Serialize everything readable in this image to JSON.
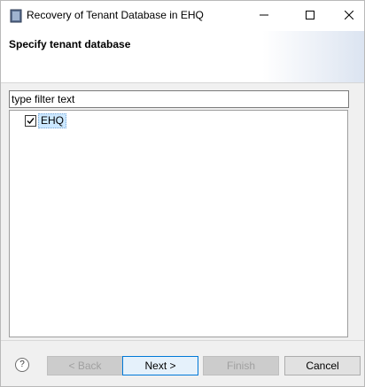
{
  "window": {
    "title": "Recovery of Tenant Database in EHQ",
    "controls": {
      "minimize": "minimize-icon",
      "maximize": "maximize-icon",
      "close": "close-icon"
    }
  },
  "banner": {
    "title": "Specify tenant database"
  },
  "filter": {
    "placeholder": "type filter text",
    "value": ""
  },
  "tree": {
    "items": [
      {
        "label": "EHQ",
        "checked": true,
        "selected": true
      }
    ]
  },
  "footer": {
    "help_icon": "help-icon",
    "back_label": "< Back",
    "next_label": "Next >",
    "finish_label": "Finish",
    "cancel_label": "Cancel"
  },
  "colors": {
    "selection": "#cce8ff",
    "default_button_border": "#0078d7"
  }
}
